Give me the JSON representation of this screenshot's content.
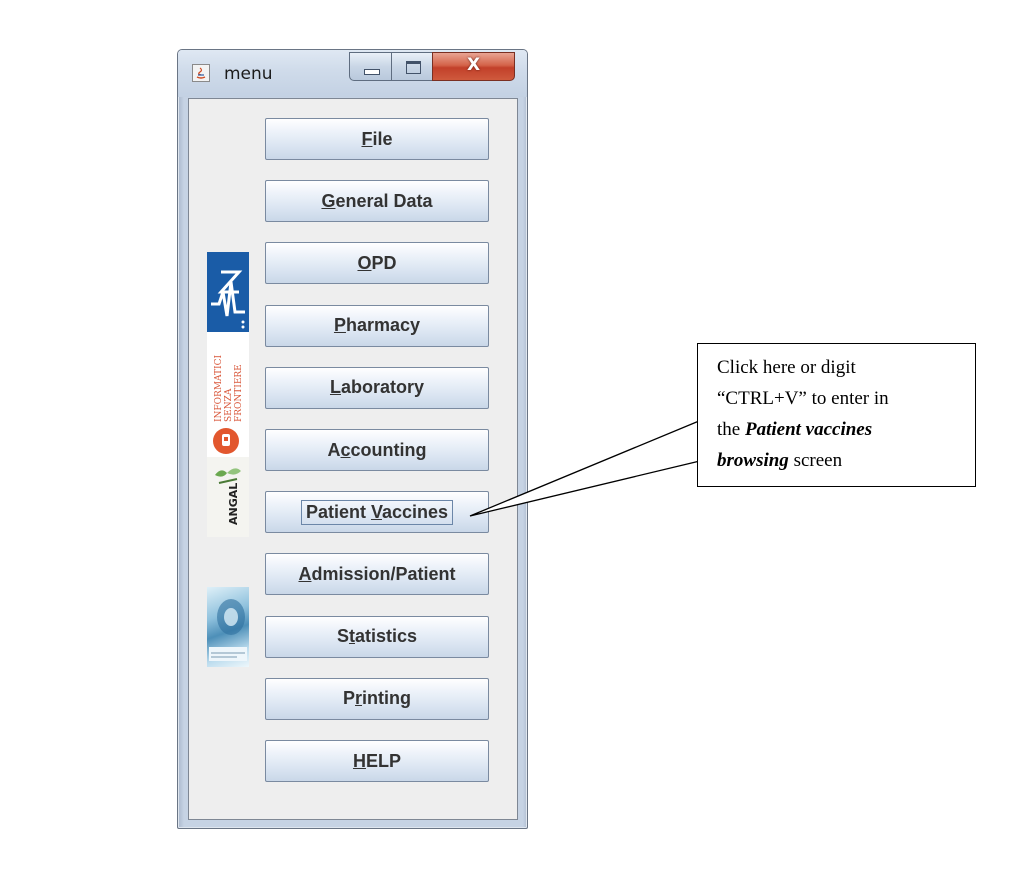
{
  "window": {
    "title": "menu",
    "controls": {
      "minimize": "minimize",
      "maximize": "maximize",
      "close": "X"
    }
  },
  "logos": [
    "ASMN logo",
    "INFORMATICI SENZA FRONTIERE",
    "ANGAL",
    "medical photo"
  ],
  "menu": {
    "buttons": [
      {
        "pre": "",
        "mn": "F",
        "post": "ile"
      },
      {
        "pre": "",
        "mn": "G",
        "post": "eneral Data"
      },
      {
        "pre": "",
        "mn": "O",
        "post": "PD"
      },
      {
        "pre": "",
        "mn": "P",
        "post": "harmacy"
      },
      {
        "pre": "",
        "mn": "L",
        "post": "aboratory"
      },
      {
        "pre": "A",
        "mn": "c",
        "post": "counting"
      },
      {
        "pre": "Patient ",
        "mn": "V",
        "post": "accines"
      },
      {
        "pre": "",
        "mn": "A",
        "post": "dmission/Patient"
      },
      {
        "pre": "S",
        "mn": "t",
        "post": "atistics"
      },
      {
        "pre": "P",
        "mn": "r",
        "post": "inting"
      },
      {
        "pre": "",
        "mn": "H",
        "post": "ELP"
      }
    ]
  },
  "callout": {
    "line1": "Click here or digit",
    "line2": "“CTRL+V” to enter in",
    "line3_pre": "the ",
    "line3_bold": "Patient vaccines",
    "line4_bold": "browsing",
    "line4_post": " screen"
  }
}
